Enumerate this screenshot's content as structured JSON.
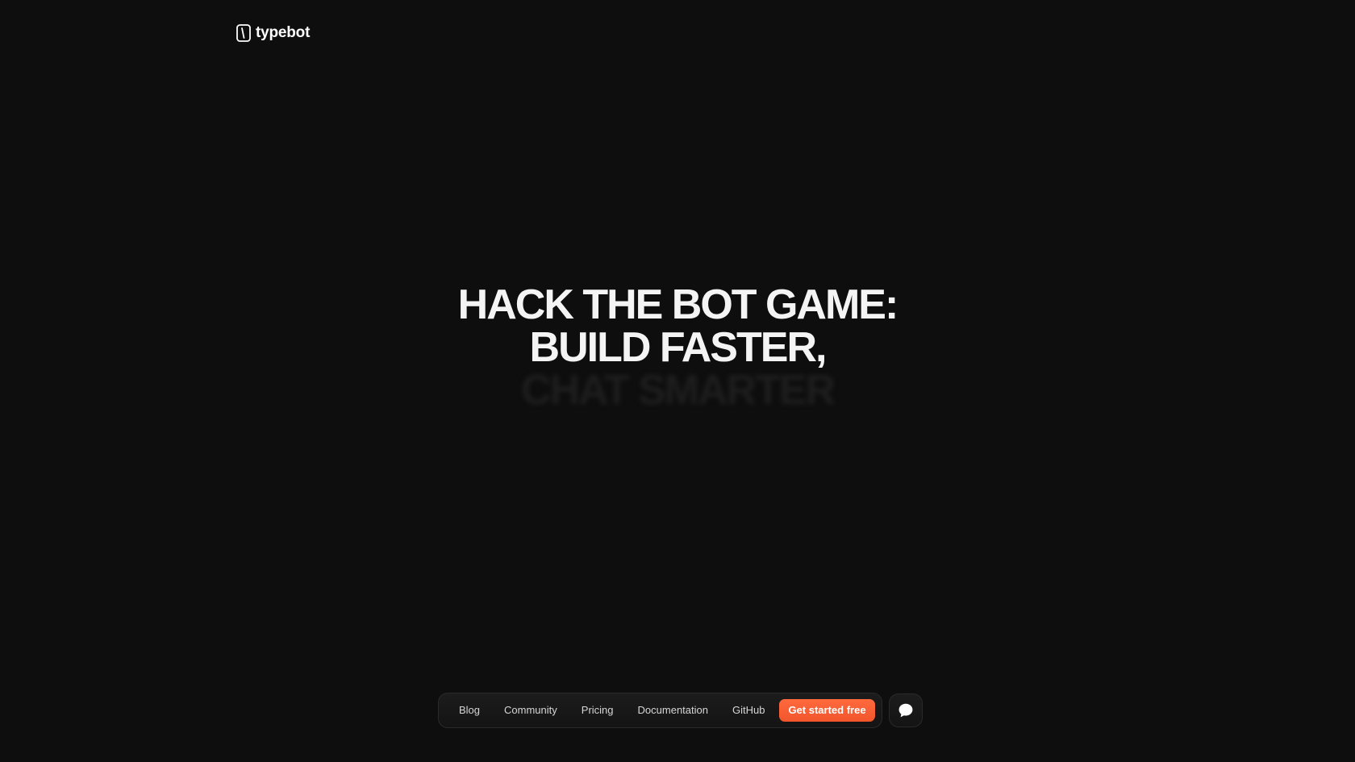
{
  "brand": {
    "name": "typebot",
    "icon": "typebot-logo-icon"
  },
  "hero": {
    "lines": [
      "HACK THE BOT GAME:",
      "BUILD FASTER,",
      "CHAT SMARTER"
    ]
  },
  "nav": {
    "links": [
      {
        "label": "Blog"
      },
      {
        "label": "Community"
      },
      {
        "label": "Pricing"
      },
      {
        "label": "Documentation"
      },
      {
        "label": "GitHub"
      }
    ],
    "cta_label": "Get started free",
    "chat_icon": "chat-bubble-icon"
  },
  "colors": {
    "background": "#0e0e0e",
    "accent": "#ff5c35",
    "text": "#f4f4f4"
  }
}
